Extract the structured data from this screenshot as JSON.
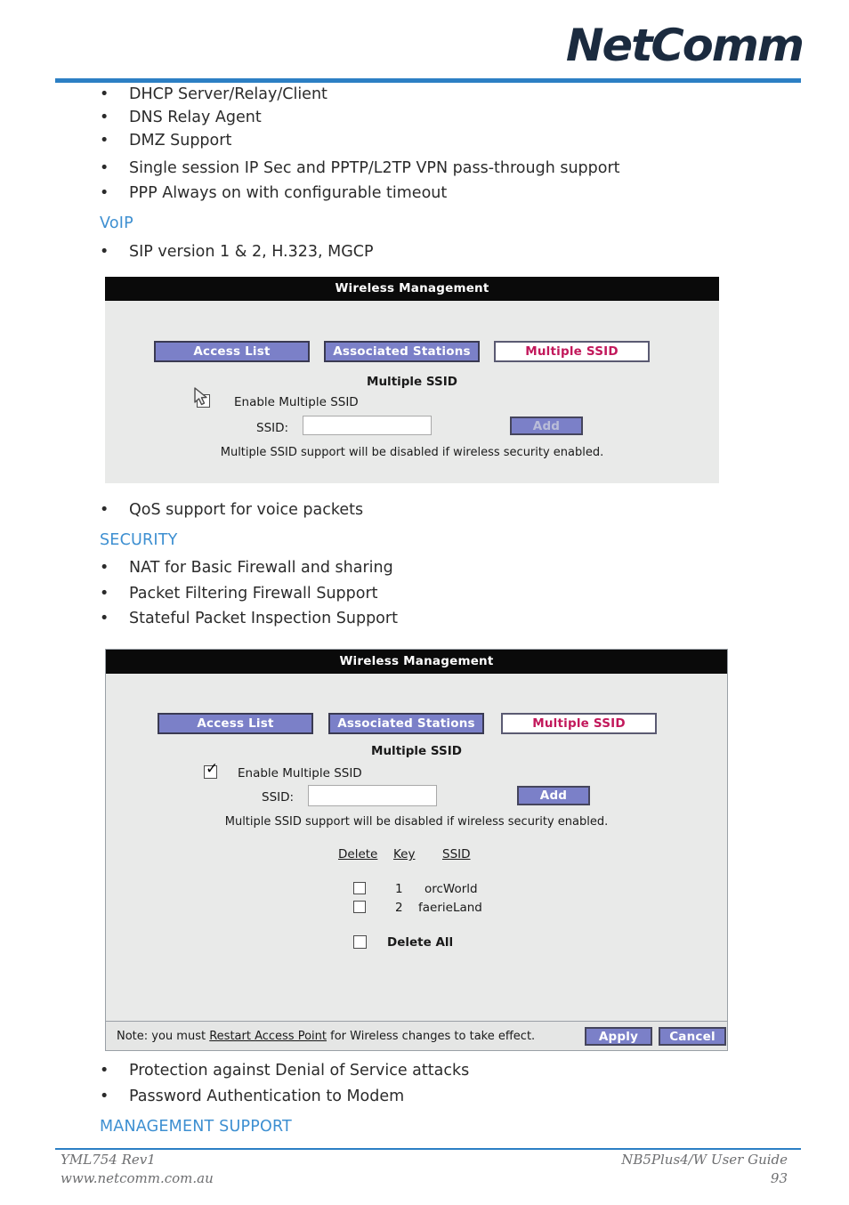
{
  "brand": {
    "logo_text": "NetComm",
    "trademark": "™"
  },
  "content": {
    "bullets_top": [
      "DHCP Server/Relay/Client",
      "DNS Relay Agent",
      "DMZ Support",
      "Single session IP Sec and PPTP/L2TP VPN pass-through support",
      "PPP Always on with configurable timeout"
    ],
    "heading_voip": "VoIP",
    "bullet_voip": "SIP version 1 & 2, H.323, MGCP",
    "bullet_qos": "QoS support for voice packets",
    "heading_security": "SECURITY",
    "bullets_security": [
      "NAT for Basic Firewall and sharing",
      "Packet Filtering Firewall Support",
      "Stateful Packet Inspection Support"
    ],
    "bullets_bottom": [
      "Protection against Denial of Service attacks",
      "Password Authentication to Modem"
    ],
    "heading_management": "MANAGEMENT SUPPORT",
    "bullet_char": "•"
  },
  "panel1": {
    "title": "Wireless Management",
    "tabs": [
      {
        "label": "Access List",
        "active": false
      },
      {
        "label": "Associated Stations",
        "active": false
      },
      {
        "label": "Multiple SSID",
        "active": true
      }
    ],
    "section_heading": "Multiple SSID",
    "enable_label": "Enable Multiple SSID",
    "enable_checked": "false",
    "ssid_label": "SSID:",
    "ssid_value": "",
    "add_button": "Add",
    "add_button_enabled": "false",
    "note": "Multiple SSID support will be disabled if wireless security enabled."
  },
  "panel2": {
    "title": "Wireless Management",
    "tabs": [
      {
        "label": "Access List",
        "active": false
      },
      {
        "label": "Associated Stations",
        "active": false
      },
      {
        "label": "Multiple SSID",
        "active": true
      }
    ],
    "section_heading": "Multiple SSID",
    "enable_label": "Enable Multiple SSID",
    "enable_checked": "true",
    "ssid_label": "SSID:",
    "ssid_value": "",
    "add_button": "Add",
    "add_button_enabled": "true",
    "note": "Multiple SSID support will be disabled if wireless security enabled.",
    "table": {
      "headers": [
        "Delete",
        "Key",
        "SSID"
      ],
      "rows": [
        {
          "key": "1",
          "ssid": "orcWorld",
          "checked": "false"
        },
        {
          "key": "2",
          "ssid": "faerieLand",
          "checked": "false"
        }
      ],
      "delete_all_label": "Delete All",
      "delete_all_checked": "false"
    },
    "footer": {
      "note_prefix": "Note: you must ",
      "note_link": "Restart Access Point",
      "note_suffix": " for Wireless changes to take effect.",
      "apply_button": "Apply",
      "cancel_button": "Cancel"
    }
  },
  "page_footer": {
    "doc_code": "YML754 Rev1",
    "website": "www.netcomm.com.au",
    "guide_title": "NB5Plus4/W User Guide",
    "page_number": "93"
  },
  "colors": {
    "accent_blue": "#3d8fd1",
    "rule_blue": "#2c7fc4",
    "tab_purple": "#7b80c8",
    "active_tab_text": "#c2185b",
    "panel_bg": "#e9eae9",
    "title_bar": "#0a0a0a"
  }
}
